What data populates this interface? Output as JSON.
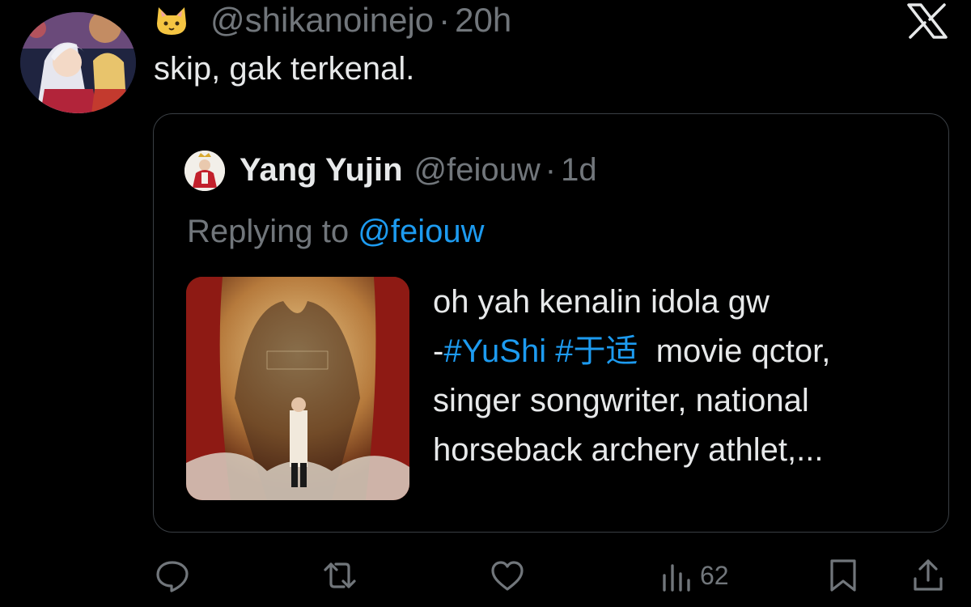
{
  "tweet": {
    "author_emoji": "🐱",
    "handle": "@shikanoinejo",
    "separator": "·",
    "time": "20h",
    "text": "skip, gak terkenal."
  },
  "quoted": {
    "name": "Yang Yujin",
    "handle": "@feiouw",
    "separator": "·",
    "time": "1d",
    "replying_label": "Replying to ",
    "replying_handle": "@feiouw",
    "line1": "oh yah kenalin idola gw",
    "line2_prefix": "-",
    "hashtag1": "#YuShi",
    "hashtag2": "#于适",
    "line2_suffix": "  movie qctor,",
    "line3": "singer songwriter, national",
    "line4": "horseback archery athlet,..."
  },
  "actions": {
    "views_count": "62"
  },
  "icons": [
    "x-logo-icon",
    "reply-icon",
    "retweet-icon",
    "like-icon",
    "views-icon",
    "bookmark-icon",
    "share-icon"
  ],
  "colors": {
    "background": "#000000",
    "text": "#e7e9ea",
    "muted": "#71767b",
    "accent": "#1d9bf0",
    "border": "#3a3f44"
  }
}
